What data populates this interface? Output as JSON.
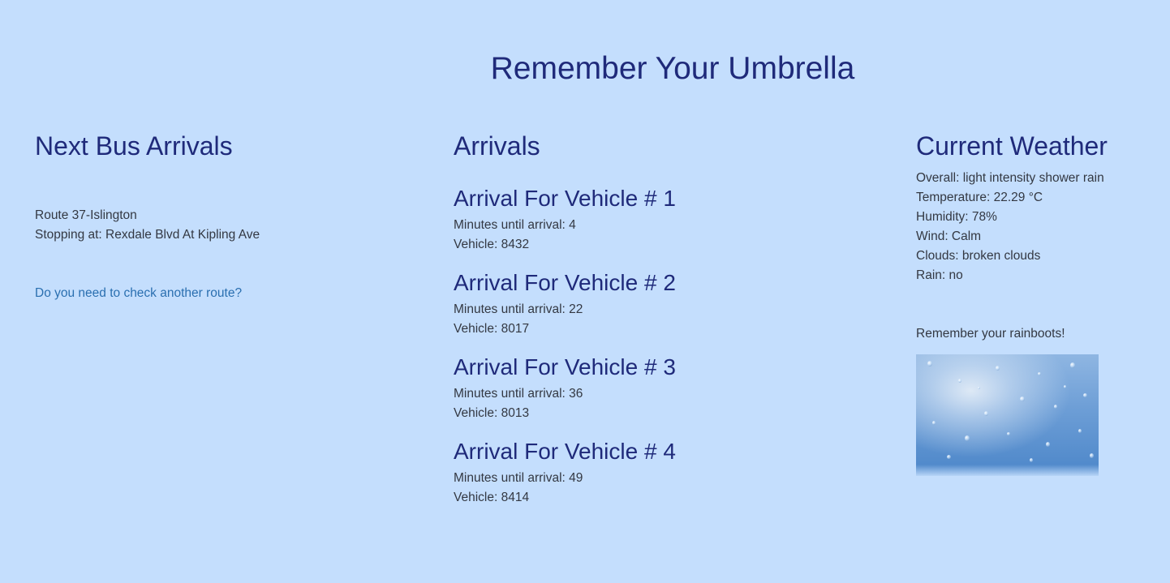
{
  "header": {
    "title": "Remember Your Umbrella"
  },
  "bus": {
    "heading": "Next Bus Arrivals",
    "route": "Route 37-Islington",
    "stop": "Stopping at: Rexdale Blvd At Kipling Ave",
    "link_label": "Do you need to check another route?"
  },
  "arrivals": {
    "heading": "Arrivals",
    "items": [
      {
        "title": "Arrival For Vehicle # 1",
        "minutes": "Minutes until arrival: 4",
        "vehicle": "Vehicle: 8432"
      },
      {
        "title": "Arrival For Vehicle # 2",
        "minutes": "Minutes until arrival: 22",
        "vehicle": "Vehicle: 8017"
      },
      {
        "title": "Arrival For Vehicle # 3",
        "minutes": "Minutes until arrival: 36",
        "vehicle": "Vehicle: 8013"
      },
      {
        "title": "Arrival For Vehicle # 4",
        "minutes": "Minutes until arrival: 49",
        "vehicle": "Vehicle: 8414"
      }
    ]
  },
  "weather": {
    "heading": "Current Weather",
    "overall": "Overall: light intensity shower rain",
    "temperature": "Temperature: 22.29 °C",
    "humidity": "Humidity: 78%",
    "wind": "Wind: Calm",
    "clouds": "Clouds: broken clouds",
    "rain": "Rain: no",
    "reminder": "Remember your rainboots!",
    "image_icon": "raindrops-image"
  },
  "colors": {
    "background": "#c4defd",
    "heading": "#1f2a7a",
    "link": "#2a6fb0",
    "text": "#333842"
  }
}
